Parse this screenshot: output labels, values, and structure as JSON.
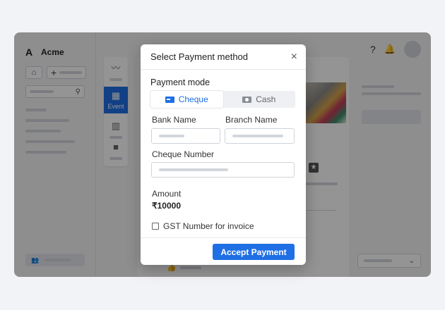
{
  "app": {
    "brand": "Acme",
    "brand_logo": "A"
  },
  "sidebar": {
    "home_icon": "home-icon",
    "new_button_icon": "plus-icon",
    "search_icon": "search-icon"
  },
  "rail": {
    "active_label": "Event"
  },
  "header": {
    "help_icon": "?",
    "bell_icon": "bell-icon"
  },
  "modal": {
    "title": "Select Payment method",
    "close_icon": "×",
    "payment_mode_label": "Payment mode",
    "modes": [
      {
        "label": "Cheque",
        "selected": true
      },
      {
        "label": "Cash",
        "selected": false
      }
    ],
    "bank_name_label": "Bank Name",
    "branch_name_label": "Branch Name",
    "cheque_number_label": "Cheque Number",
    "amount_label": "Amount",
    "amount_value": "₹10000",
    "gst_label": "GST Number for invoice",
    "accept_label": "Accept Payment"
  },
  "colors": {
    "accent": "#1f6fe5",
    "overlay": "rgba(0,0,0,0.42)"
  }
}
